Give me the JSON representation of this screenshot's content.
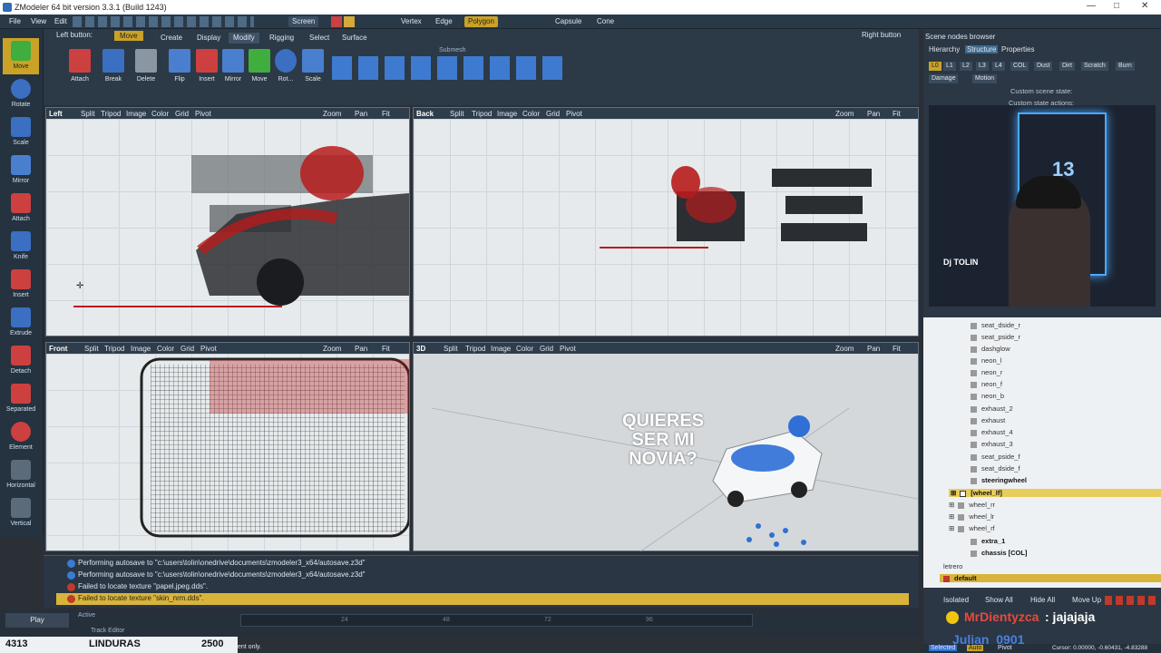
{
  "window": {
    "title": "ZModeler 64 bit version 3.3.1 (Build 1243)"
  },
  "menu": [
    "File",
    "View",
    "Edit"
  ],
  "toolbar": {
    "screen": "Screen",
    "vertex": "Vertex",
    "edge": "Edge",
    "polygon": "Polygon",
    "capsule": "Capsule",
    "cone": "Cone"
  },
  "left_tools": [
    "Move",
    "Rotate",
    "Scale",
    "Mirror",
    "Attach",
    "Knife",
    "Insert",
    "Extrude",
    "Detach",
    "Separated",
    "Element",
    "Horizontal",
    "Vertical"
  ],
  "ribbon": {
    "left_button": "Left button:",
    "move_chip": "Move",
    "tabs": [
      "Create",
      "Display",
      "Modify",
      "Rigging",
      "Select",
      "Surface"
    ],
    "submesh": "Submesh",
    "buttons": [
      "Attach",
      "Break",
      "Delete",
      "Flip",
      "Insert",
      "Mirror",
      "Move",
      "Rot...",
      "Scale"
    ],
    "right_button": "Right button"
  },
  "viewports": [
    {
      "name": "Left",
      "items": [
        "Split",
        "Tripod",
        "Image",
        "Color",
        "Grid",
        "Pivot"
      ],
      "zoom": "Zoom",
      "pan": "Pan",
      "fit": "Fit"
    },
    {
      "name": "Back",
      "items": [
        "Split",
        "Tripod",
        "Image",
        "Color",
        "Grid",
        "Pivot"
      ],
      "zoom": "Zoom",
      "pan": "Pan",
      "fit": "Fit"
    },
    {
      "name": "Front",
      "items": [
        "Split",
        "Tripod",
        "Image",
        "Color",
        "Grid",
        "Pivot"
      ],
      "zoom": "Zoom",
      "pan": "Pan",
      "fit": "Fit"
    },
    {
      "name": "3D",
      "items": [
        "Split",
        "Tripod",
        "Image",
        "Color",
        "Grid",
        "Pivot"
      ],
      "zoom": "Zoom",
      "pan": "Pan",
      "fit": "Fit"
    }
  ],
  "overlay_text": [
    "QUIERES",
    "SER MI",
    "NOVIA?"
  ],
  "log": [
    {
      "kind": "info",
      "text": "Performing autosave to \"c:\\users\\tolin\\onedrive\\documents\\zmodeler3_x64/autosave.z3d\""
    },
    {
      "kind": "info",
      "text": "Performing autosave to \"c:\\users\\tolin\\onedrive\\documents\\zmodeler3_x64/autosave.z3d\""
    },
    {
      "kind": "error",
      "text": "Failed to locate texture \"papel.jpeg.dds\"."
    },
    {
      "kind": "error",
      "text": "Failed to locate texture \"skin_nrm.dds\"."
    }
  ],
  "timeline": {
    "play": "Play",
    "active": "Active",
    "track_editor": "Track Editor",
    "ticks": [
      "24",
      "48",
      "72",
      "96"
    ]
  },
  "status": {
    "left": "4313",
    "mid": "LINDURAS",
    "right": "2500",
    "hint": "ent only."
  },
  "scene_browser": {
    "title": "Scene nodes browser",
    "tabs": [
      "Hierarchy",
      "Structure",
      "Properties"
    ],
    "chips": [
      "L0",
      "L1",
      "L2",
      "L3",
      "L4",
      "COL",
      "Dust",
      "Dirt",
      "Scratch",
      "Burn"
    ],
    "chips2": [
      "Damage",
      "Motion"
    ],
    "state_label": "Custom scene state:",
    "state_actions": "Custom state actions:"
  },
  "webcam": {
    "badge": "13",
    "brand": "Dj TOLIN"
  },
  "tree": [
    "seat_dside_r",
    "seat_pside_r",
    "dashglow",
    "neon_l",
    "neon_r",
    "neon_f",
    "neon_b",
    "exhaust_2",
    "exhaust",
    "exhaust_4",
    "exhaust_3",
    "seat_pside_f",
    "seat_dside_f",
    "steeringwheel",
    "[wheel_lf]",
    "wheel_rr",
    "wheel_lr",
    "wheel_rf",
    "extra_1",
    "chassis [COL]",
    "letrero",
    "default"
  ],
  "bottom_buttons": [
    "Isolated",
    "Show All",
    "Hide All",
    "Move Up"
  ],
  "chat": [
    {
      "user": "MrDientyzca",
      "msg": ": jajajaja"
    },
    {
      "user": "Julian_0901",
      "msg": ""
    }
  ],
  "coords": "Cursor: 0.00000, -0.60431, -4.83288",
  "selected": "Selected",
  "auto": "Auto",
  "pivot": "Pivot",
  "colors": {
    "accent": "#c9a227",
    "panel": "#2b3744",
    "viewport": "#e6eaec",
    "error": "#c0392b",
    "info": "#3a7bd5",
    "chat_user": "#e84a3c"
  }
}
